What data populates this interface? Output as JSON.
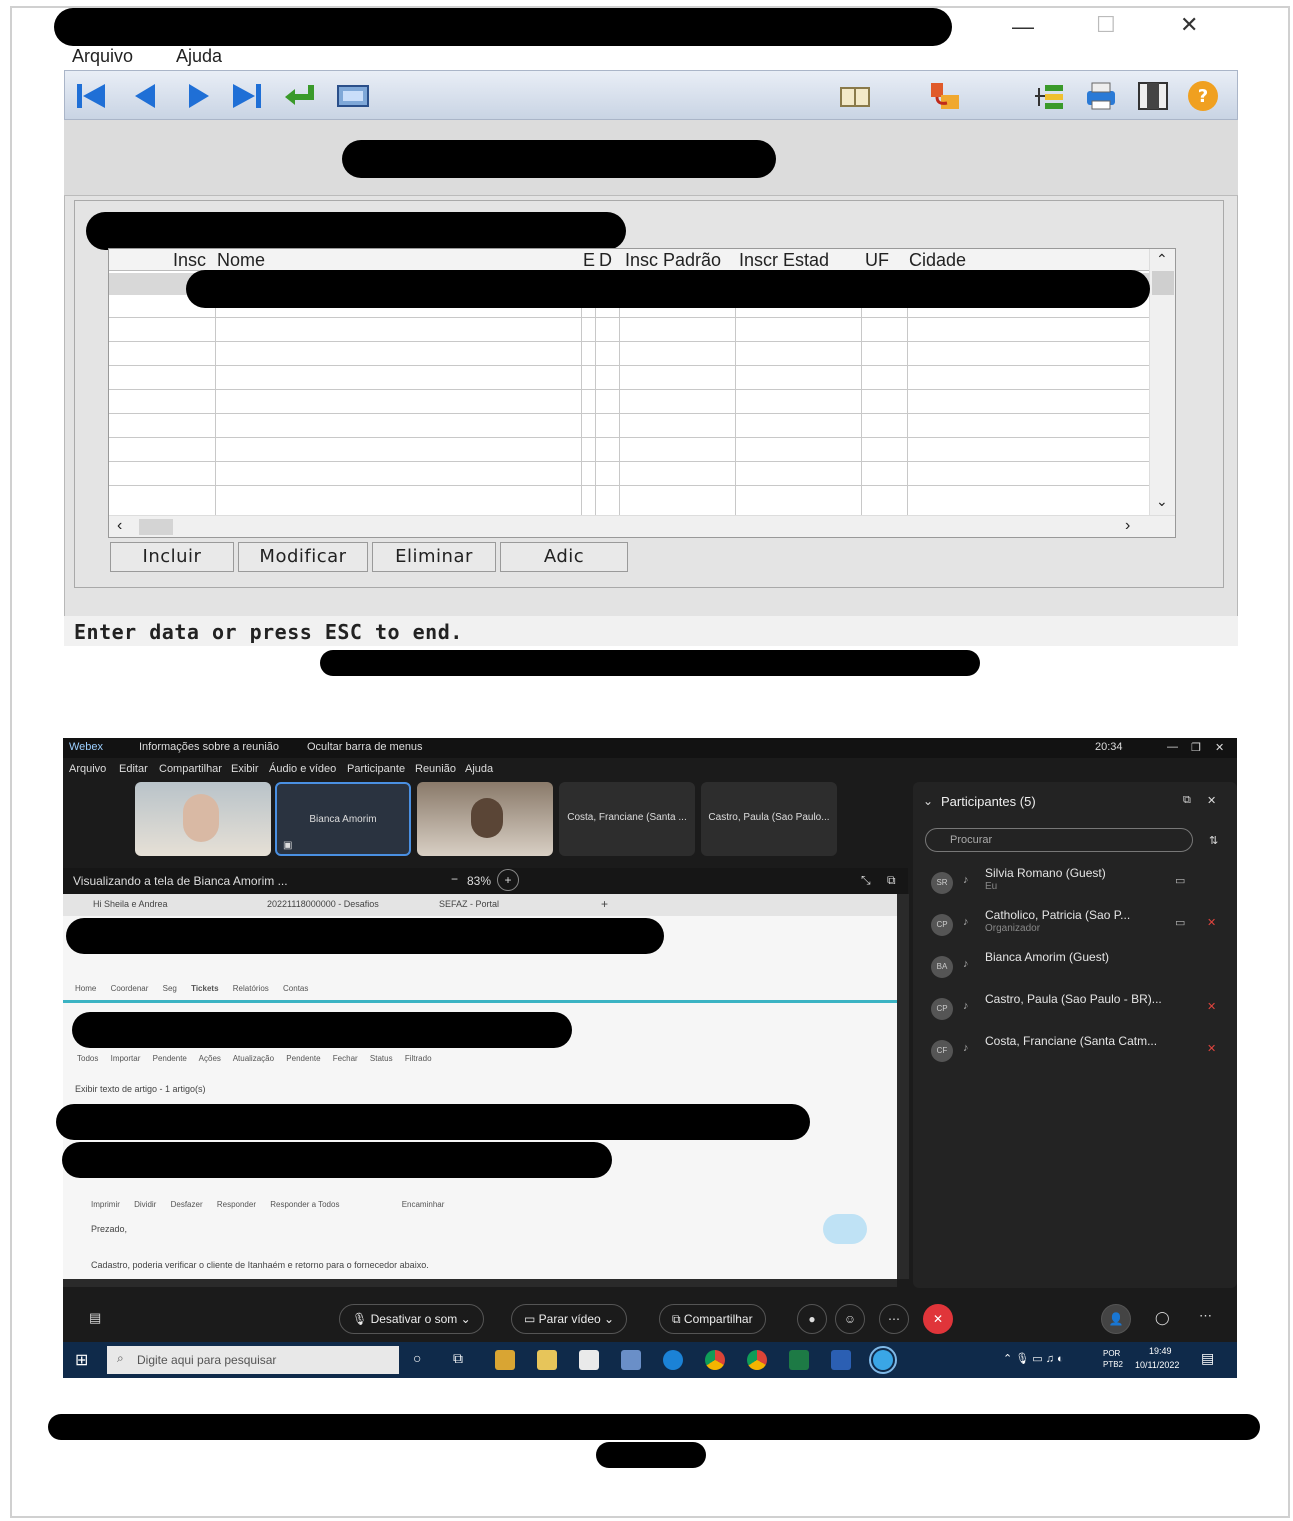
{
  "window": {
    "menu": [
      "Arquivo",
      "Ajuda"
    ],
    "toolbar_icons": [
      "first-record-icon",
      "previous-record-icon",
      "next-record-icon",
      "last-record-icon",
      "enter-icon",
      "screen-icon",
      "book-icon",
      "export-icon",
      "tree-icon",
      "print-icon",
      "columns-icon",
      "help-icon"
    ]
  },
  "grid": {
    "columns": [
      "Insc",
      "Nome",
      "E",
      "D",
      "Insc Padrão",
      "Inscr Estad",
      "UF",
      "Cidade"
    ]
  },
  "buttons": [
    "Incluir",
    "Modificar",
    "Eliminar",
    "Adic"
  ],
  "status": "Enter data or press ESC to end.",
  "webex": {
    "title_items": [
      "Webex",
      "Informações sobre a reunião",
      "Ocultar barra de menus"
    ],
    "clock": "20:34",
    "menu": [
      "Arquivo",
      "Editar",
      "Compartilhar",
      "Exibir",
      "Áudio e vídeo",
      "Participante",
      "Reunião",
      "Ajuda"
    ],
    "thumbnails": [
      "",
      "Bianca Amorim",
      "",
      "Costa, Franciane (Santa ...",
      "Castro, Paula (Sao Paulo..."
    ],
    "viewing": "Visualizando a tela de Bianca Amorim ...",
    "zoom": "83%",
    "browser_tabs": [
      "Hi Sheila e Andrea",
      "20221118000000 - Desafios",
      "SEFAZ - Portal"
    ],
    "share_nav": [
      "Home",
      "Coordenar",
      "Seg",
      "Tickets",
      "Relatórios",
      "Contas"
    ],
    "share_filters": [
      "Todos",
      "Importar",
      "Pendente",
      "Ações",
      "Atualização",
      "Pendente",
      "Fechar",
      "Status",
      "Filtrado"
    ],
    "share_misc": "Exibir texto de artigo - 1 artigo(s)",
    "share_actions": [
      "Imprimir",
      "Dividir",
      "Desfazer",
      "Responder",
      "Responder a Todos",
      "Encaminhar"
    ],
    "share_greeting": "Prezado,",
    "share_body": "Cadastro, poderia verificar o cliente de Itanhaém e retorno para o fornecedor abaixo.",
    "participants_title": "Participantes (5)",
    "search_placeholder": "Procurar",
    "participants": [
      {
        "initials": "SR",
        "name": "Silvia Romano (Guest)",
        "role": "Eu"
      },
      {
        "initials": "CP",
        "name": "Catholico, Patricia (Sao P...",
        "role": "Organizador"
      },
      {
        "initials": "BA",
        "name": "Bianca Amorim (Guest)",
        "role": ""
      },
      {
        "initials": "CP",
        "name": "Castro, Paula (Sao Paulo - BR)...",
        "role": ""
      },
      {
        "initials": "CF",
        "name": "Costa, Franciane (Santa Catm...",
        "role": ""
      }
    ],
    "controls": [
      "Desativar o som",
      "Parar vídeo",
      "Compartilhar"
    ],
    "taskbar_search": "Digite aqui para pesquisar",
    "taskbar_lang": "POR PTB2",
    "taskbar_time": "19:49",
    "taskbar_date": "10/11/2022"
  }
}
